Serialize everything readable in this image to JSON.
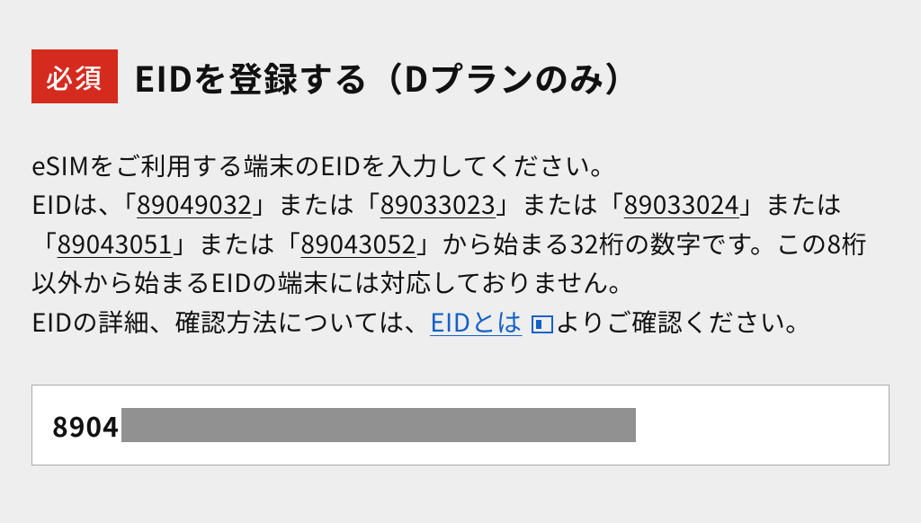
{
  "header": {
    "required_badge": "必須",
    "title": "EIDを登録する（Dプランのみ）"
  },
  "description": {
    "line1": "eSIMをご利用する端末のEIDを入力してください。",
    "prefix_intro": "EIDは、「",
    "prefixes": [
      "89049032",
      "89033023",
      "89033024",
      "89043051",
      "89043052"
    ],
    "joiner": "」または「",
    "prefix_outro": "」から始まる32桁の数字です。この8桁以外から始まるEIDの端末には対応しておりません。",
    "detail_prefix": "EIDの詳細、確認方法については、",
    "link_text": "EIDとは",
    "detail_suffix": "よりご確認ください。"
  },
  "input": {
    "visible_value": "8904"
  }
}
